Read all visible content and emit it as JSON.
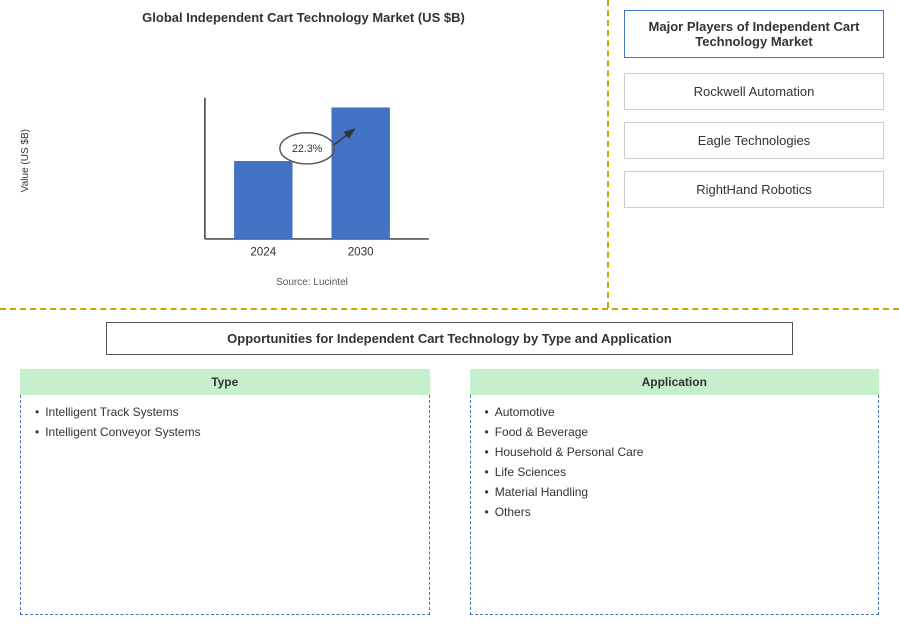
{
  "chart": {
    "title": "Global Independent Cart Technology Market (US $B)",
    "y_axis_label": "Value (US $B)",
    "source": "Source: Lucintel",
    "bars": [
      {
        "year": "2024",
        "height": 80
      },
      {
        "year": "2030",
        "height": 140
      }
    ],
    "annotation": {
      "value": "22.3%",
      "arrow": "→"
    }
  },
  "players": {
    "title": "Major Players of Independent Cart Technology Market",
    "items": [
      {
        "name": "Rockwell Automation"
      },
      {
        "name": "Eagle Technologies"
      },
      {
        "name": "RightHand Robotics"
      }
    ]
  },
  "opportunities": {
    "title": "Opportunities for Independent Cart Technology by Type and Application",
    "type_header": "Type",
    "type_items": [
      "Intelligent Track Systems",
      "Intelligent Conveyor Systems"
    ],
    "application_header": "Application",
    "application_items": [
      "Automotive",
      "Food & Beverage",
      "Household & Personal Care",
      "Life Sciences",
      "Material Handling",
      "Others"
    ]
  }
}
